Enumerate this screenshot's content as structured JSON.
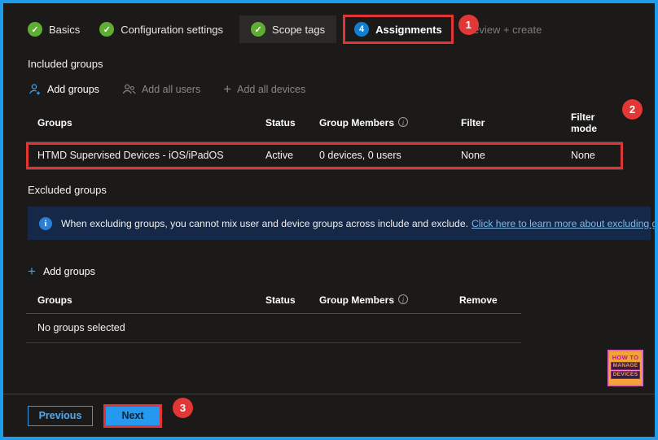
{
  "tabs": {
    "basics": "Basics",
    "configuration": "Configuration settings",
    "scope_tags": "Scope tags",
    "assignments": "Assignments",
    "assignments_step_number": "4",
    "review": "Review + create",
    "check_glyph": "✓"
  },
  "annotations": {
    "one": "1",
    "two": "2",
    "three": "3"
  },
  "included": {
    "heading": "Included groups",
    "toolbar": {
      "add_groups": "Add groups",
      "add_all_users": "Add all users",
      "add_all_devices": "Add all devices"
    },
    "headers": {
      "groups": "Groups",
      "status": "Status",
      "members": "Group Members",
      "filter": "Filter",
      "filter_mode": "Filter mode"
    },
    "row": {
      "name": "HTMD Supervised Devices - iOS/iPadOS",
      "status": "Active",
      "members": "0 devices, 0 users",
      "filter": "None",
      "filter_mode": "None"
    }
  },
  "excluded": {
    "heading": "Excluded groups",
    "banner_text": "When excluding groups, you cannot mix user and device groups across include and exclude.",
    "banner_link": "Click here to learn more about excluding groups.",
    "add_groups": "Add groups",
    "headers": {
      "groups": "Groups",
      "status": "Status",
      "members": "Group Members",
      "remove": "Remove"
    },
    "empty": "No groups selected"
  },
  "footer": {
    "previous": "Previous",
    "next": "Next"
  },
  "logo": {
    "line1": "HOW TO",
    "line2": "MANAGE",
    "line3": "DEVICES"
  },
  "misc": {
    "info_glyph": "i",
    "plus_glyph": "+"
  }
}
